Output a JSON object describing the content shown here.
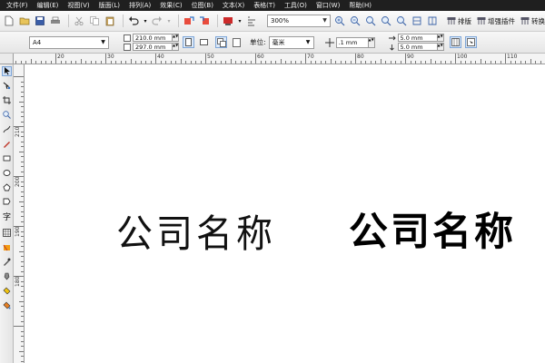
{
  "menu": [
    {
      "label": "文件(F)"
    },
    {
      "label": "编辑(E)"
    },
    {
      "label": "视图(V)"
    },
    {
      "label": "版面(L)"
    },
    {
      "label": "排列(A)"
    },
    {
      "label": "效果(C)"
    },
    {
      "label": "位图(B)"
    },
    {
      "label": "文本(X)"
    },
    {
      "label": "表格(T)"
    },
    {
      "label": "工具(O)"
    },
    {
      "label": "窗口(W)"
    },
    {
      "label": "帮助(H)"
    }
  ],
  "toolbar": {
    "zoom": "300%",
    "plugins": [
      {
        "label": "排版",
        "icon": "plugin-icon"
      },
      {
        "label": "增强插件",
        "icon": "plugin-icon"
      },
      {
        "label": "转换",
        "icon": "plugin-icon"
      }
    ]
  },
  "property_bar": {
    "page_size": "A4",
    "width": "210.0 mm",
    "height": "297.0 mm",
    "unit_label": "单位:",
    "unit": "毫米",
    "nudge": ".1 mm",
    "dup_x": "5.0 mm",
    "dup_y": "5.0 mm"
  },
  "ruler": {
    "top": [
      "20",
      "30",
      "40",
      "50",
      "60",
      "70",
      "80",
      "90",
      "100",
      "110"
    ],
    "left": [
      "210",
      "200",
      "190",
      "180"
    ]
  },
  "canvas": {
    "text_regular": "公司名称",
    "text_bold": "公司名称"
  },
  "colors": {
    "menubar": "#1f1f1f",
    "selection": "#cfe0f6"
  }
}
